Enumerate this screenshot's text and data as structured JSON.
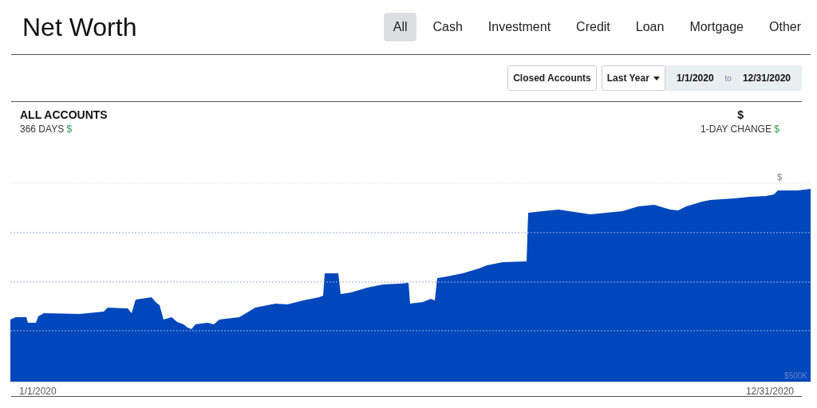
{
  "title": "Net Worth",
  "tabs": [
    {
      "label": "All",
      "selected": true
    },
    {
      "label": "Cash",
      "selected": false
    },
    {
      "label": "Investment",
      "selected": false
    },
    {
      "label": "Credit",
      "selected": false
    },
    {
      "label": "Loan",
      "selected": false
    },
    {
      "label": "Mortgage",
      "selected": false
    },
    {
      "label": "Other",
      "selected": false
    }
  ],
  "toolbar": {
    "closed_accounts": "Closed Accounts",
    "range": "Last Year",
    "date_from": "1/1/2020",
    "separator": "to",
    "date_to": "12/31/2020"
  },
  "summary": {
    "title": "ALL ACCOUNTS",
    "days_label": "366 DAYS",
    "days_value": "$",
    "total": "$",
    "change_label": "1-DAY CHANGE",
    "change_value": "$"
  },
  "chart": {
    "top_label": "$",
    "bottom_label": "$500K",
    "x_start": "1/1/2020",
    "x_end": "12/31/2020"
  }
}
